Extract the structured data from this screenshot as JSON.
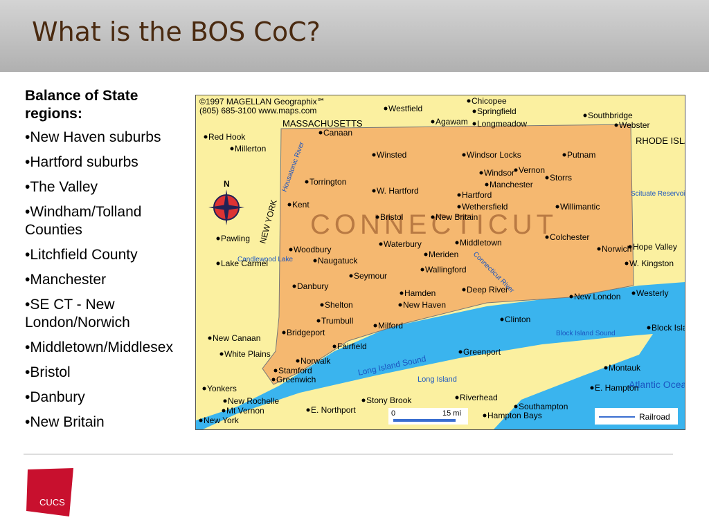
{
  "slide": {
    "title": "What is the BOS CoC?"
  },
  "regions": {
    "heading": "Balance of State regions:",
    "items": [
      "•New Haven suburbs",
      "•Hartford suburbs",
      "•The Valley",
      "•Windham/Tolland Counties",
      "•Litchfield County",
      "•Manchester",
      "•SE CT - New London/Norwich",
      "•Middletown/Middlesex",
      "•Bristol",
      "•Danbury",
      "•New Britain"
    ]
  },
  "map": {
    "copyright": "©1997 MAGELLAN Geographix℠",
    "contact": "(805) 685-3100  www.maps.com",
    "state_label": "CONNECTICUT",
    "neighbors": [
      "MASSACHUSETTS",
      "RHODE ISLAND",
      "NEW YORK"
    ],
    "water": [
      "Long Island Sound",
      "Block Island Sound",
      "Atlantic Ocean",
      "Long Island",
      "Housatonic River",
      "Connecticut River",
      "Candlewood Lake",
      "Scituate Reservoir"
    ],
    "cities": [
      "Chicopee",
      "Westfield",
      "Springfield",
      "Agawam",
      "Longmeadow",
      "Southbridge",
      "Webster",
      "Red Hook",
      "Canaan",
      "Millerton",
      "Winsted",
      "Windsor Locks",
      "Putnam",
      "Windsor",
      "Vernon",
      "Storrs",
      "Torrington",
      "W. Hartford",
      "Manchester",
      "Hartford",
      "Kent",
      "Wethersfield",
      "Willimantic",
      "Bristol",
      "New Britain",
      "Pawling",
      "Waterbury",
      "Middletown",
      "Colchester",
      "Norwich",
      "Hope Valley",
      "Woodbury",
      "Naugatuck",
      "Meriden",
      "W. Kingston",
      "Lake Carmel",
      "Wallingford",
      "Seymour",
      "Danbury",
      "Hamden",
      "Deep River",
      "Westerly",
      "Shelton",
      "New Haven",
      "New London",
      "Trumbull",
      "Milford",
      "Clinton",
      "Bridgeport",
      "Block Island",
      "New Canaan",
      "Fairfield",
      "Greenport",
      "White Plains",
      "Norwalk",
      "Stamford",
      "Montauk",
      "Greenwich",
      "Yonkers",
      "E. Hampton",
      "New Rochelle",
      "Stony Brook",
      "Riverhead",
      "Southampton",
      "Mt Vernon",
      "E. Northport",
      "Hampton Bays",
      "New York"
    ],
    "scale": {
      "start": "0",
      "end": "15 mi"
    },
    "legend": "Railroad",
    "compass": "N",
    "colors": {
      "ct": "#f5b870",
      "land": "#fbf0a0",
      "water": "#3ab4ee",
      "border": "#888"
    }
  },
  "logo": {
    "text": "CUCS",
    "color": "#c8102e"
  }
}
